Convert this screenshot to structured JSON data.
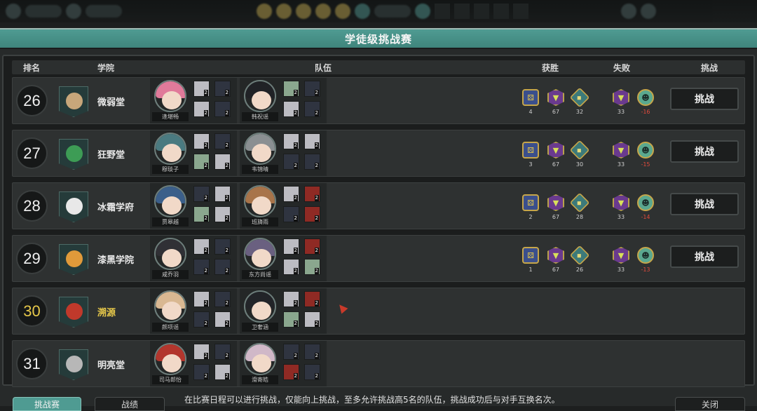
{
  "title": "学徒级挑战赛",
  "headers": {
    "rank": "排名",
    "school": "学院",
    "team": "队伍",
    "win": "获胜",
    "lose": "失败",
    "challenge": "挑战"
  },
  "rows": [
    {
      "rank": "26",
      "school": "微弱堂",
      "leader1": "逢堪畅",
      "leader2": "韩祝谣",
      "win": [
        "4",
        "67",
        "32"
      ],
      "lose": [
        "33",
        "-16"
      ],
      "button": "挑战"
    },
    {
      "rank": "27",
      "school": "狂野堂",
      "leader1": "穆琰子",
      "leader2": "韦锦晴",
      "win": [
        "3",
        "67",
        "30"
      ],
      "lose": [
        "33",
        "-15"
      ],
      "button": "挑战"
    },
    {
      "rank": "28",
      "school": "冰霜学府",
      "leader1": "贾皋越",
      "leader2": "班旖雨",
      "win": [
        "2",
        "67",
        "28"
      ],
      "lose": [
        "33",
        "-14"
      ],
      "button": "挑战"
    },
    {
      "rank": "29",
      "school": "漆黑学院",
      "leader1": "咸乔羽",
      "leader2": "东方尚谣",
      "win": [
        "1",
        "67",
        "26"
      ],
      "lose": [
        "33",
        "-13"
      ],
      "button": "挑战"
    },
    {
      "rank": "30",
      "school": "溯源",
      "leader1": "颜项谣",
      "leader2": "卫奢涵",
      "win": [],
      "lose": [],
      "button": ""
    },
    {
      "rank": "31",
      "school": "明亮堂",
      "leader1": "司马郎怡",
      "leader2": "滑寄皓",
      "win": [],
      "lose": [],
      "button": ""
    }
  ],
  "footer": {
    "rules_line1": "在比赛日程可以进行挑战，仅能向上挑战，至多允许挑战高5名的队伍，挑战成功后与对手互换名次。",
    "primary_label": "挑战赛",
    "secondary_label": "战绩",
    "right_label": "关闭"
  },
  "colors": {
    "accent": "#4f9b92",
    "own_team": "#e6c84a",
    "negative": "#e24a3c"
  },
  "icons": {
    "win_badges": [
      "dice-badge-icon",
      "triangle-gem-icon",
      "diamond-badge-icon"
    ],
    "lose_badges": [
      "triangle-gem-icon",
      "alien-coin-icon"
    ]
  }
}
